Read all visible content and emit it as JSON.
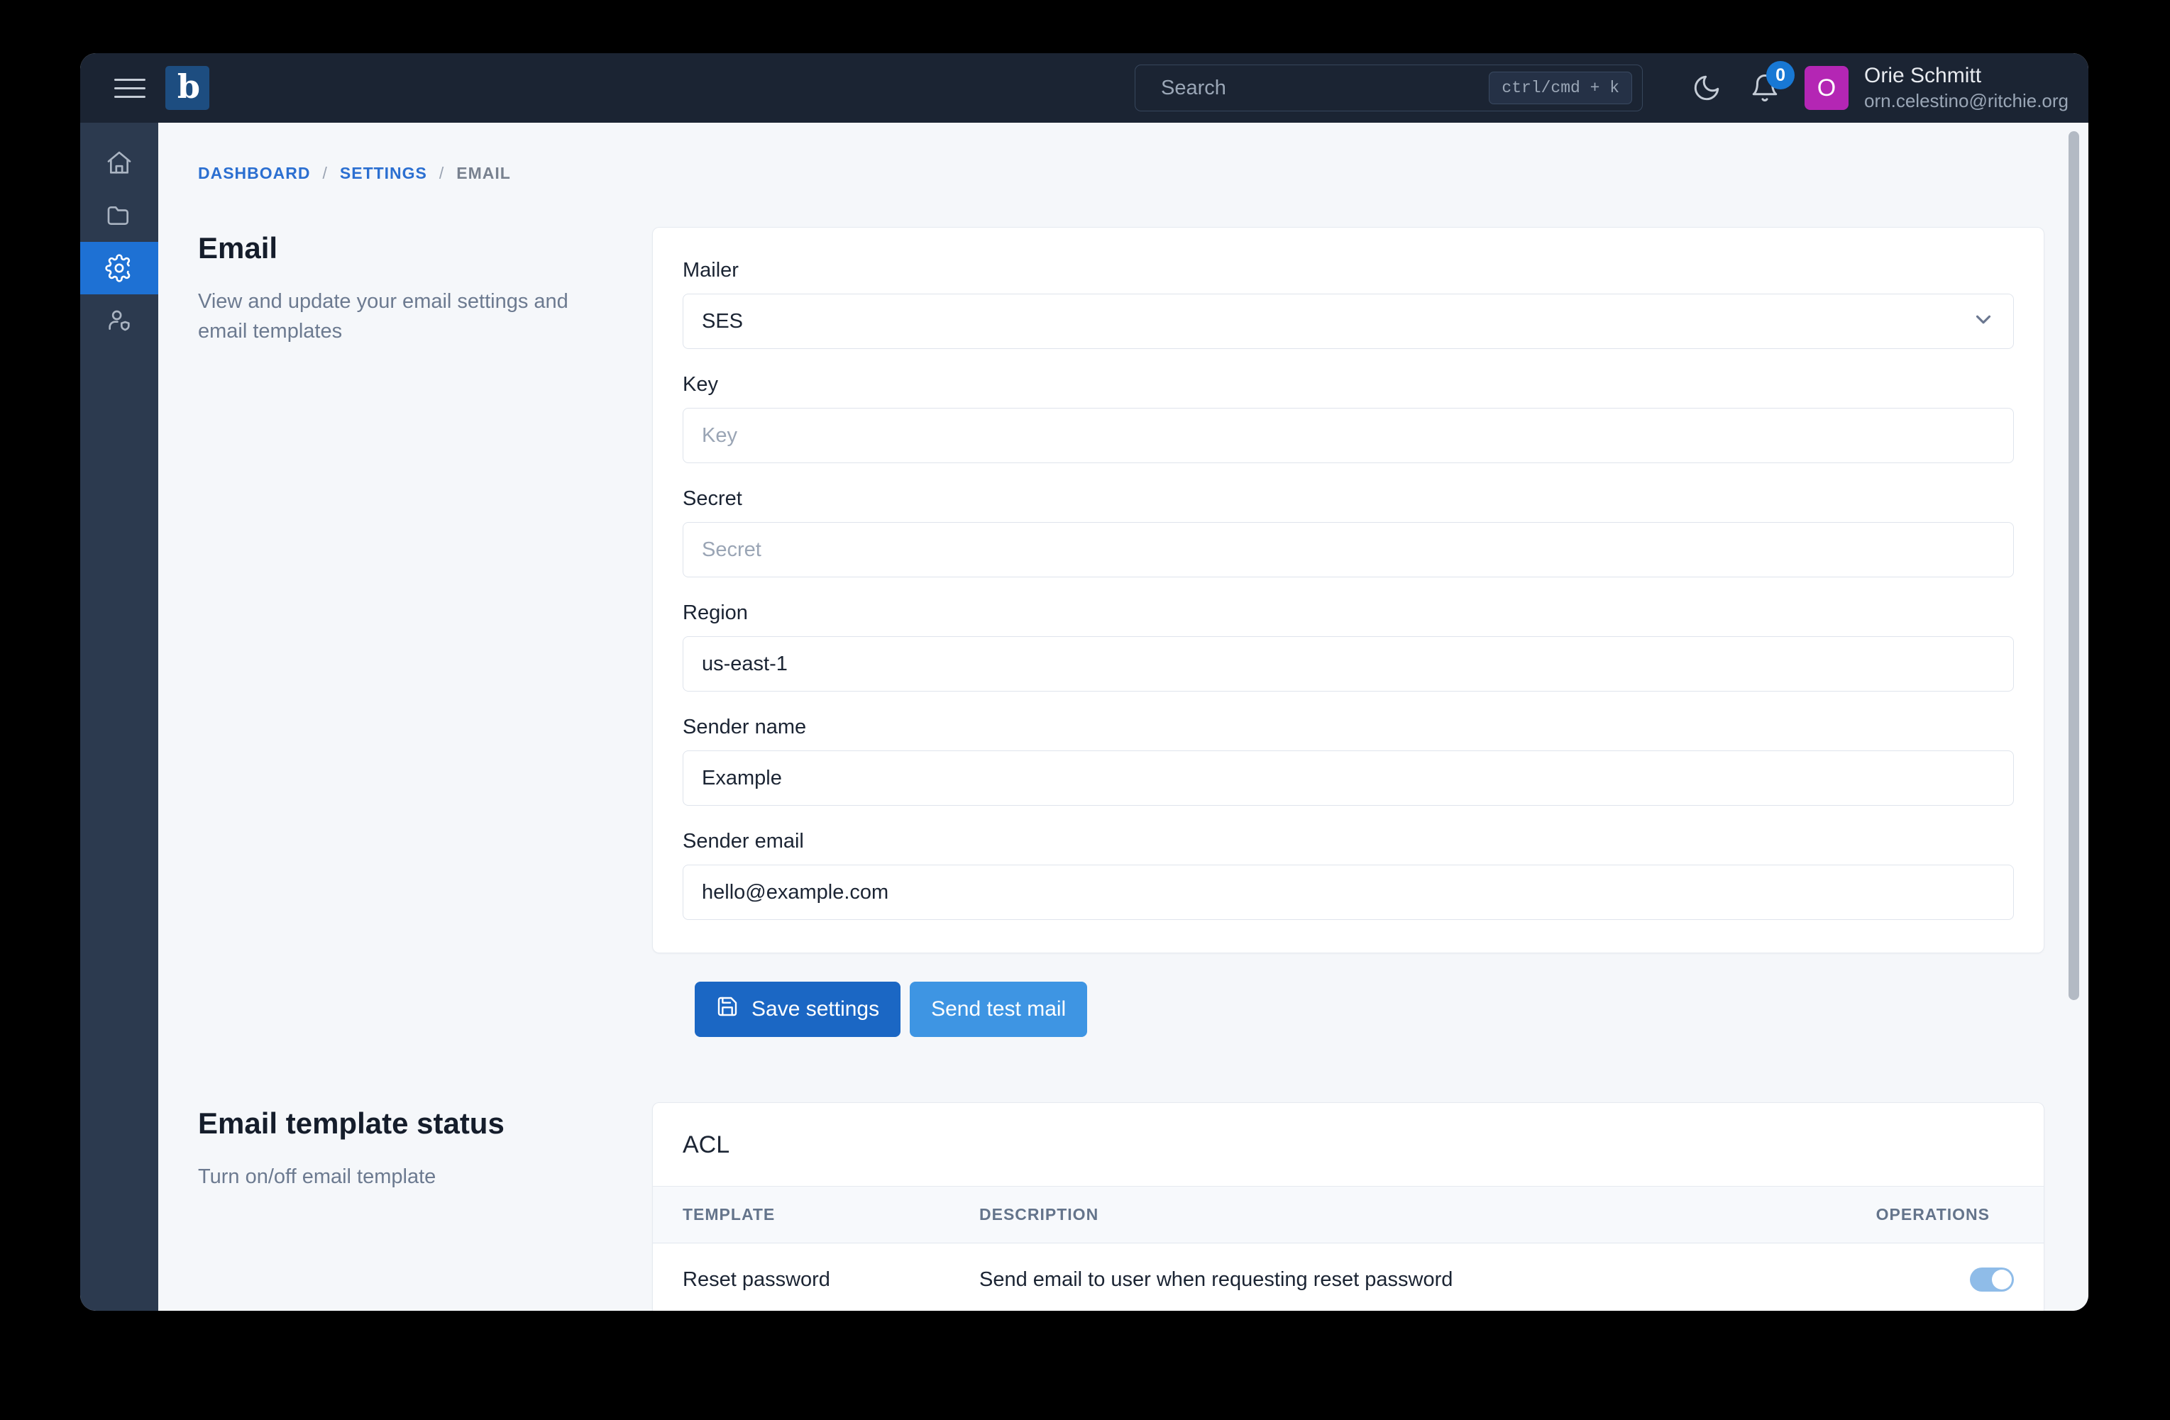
{
  "topbar": {
    "menu_label": "Menu",
    "brand_letter": "b",
    "search": {
      "placeholder": "Search",
      "shortcut": "ctrl/cmd + k"
    },
    "theme_toggle_label": "Dark mode",
    "notifications_count": "0",
    "user": {
      "initial": "O",
      "name": "Orie Schmitt",
      "email": "orn.celestino@ritchie.org",
      "avatar_color": "#b426b4"
    }
  },
  "sidebar": {
    "items": [
      {
        "id": "home",
        "icon": "home-icon",
        "active": false
      },
      {
        "id": "files",
        "icon": "folder-icon",
        "active": false
      },
      {
        "id": "settings",
        "icon": "gear-icon",
        "active": true
      },
      {
        "id": "users",
        "icon": "user-shield-icon",
        "active": false
      }
    ],
    "active_color": "#1e71d4"
  },
  "breadcrumb": {
    "items": [
      {
        "label": "DASHBOARD",
        "link": true
      },
      {
        "label": "SETTINGS",
        "link": true
      },
      {
        "label": "EMAIL",
        "link": false
      }
    ],
    "separator": "/"
  },
  "email_section": {
    "title": "Email",
    "description": "View and update your email settings and email templates",
    "fields": {
      "mailer": {
        "label": "Mailer",
        "value": "SES",
        "type": "select"
      },
      "key": {
        "label": "Key",
        "value": "",
        "placeholder": "Key"
      },
      "secret": {
        "label": "Secret",
        "value": "",
        "placeholder": "Secret"
      },
      "region": {
        "label": "Region",
        "value": "us-east-1",
        "placeholder": "Region"
      },
      "sender_name": {
        "label": "Sender name",
        "value": "Example",
        "placeholder": "Sender name"
      },
      "sender_email": {
        "label": "Sender email",
        "value": "hello@example.com",
        "placeholder": "Sender email"
      }
    }
  },
  "actions": {
    "save_label": "Save settings",
    "save_icon": "save-icon",
    "save_color": "#1b67c4",
    "test_label": "Send test mail",
    "test_color": "#3e95e3"
  },
  "template_section": {
    "title": "Email template status",
    "description": "Turn on/off email template",
    "card_title": "ACL",
    "columns": [
      "TEMPLATE",
      "DESCRIPTION",
      "OPERATIONS"
    ],
    "rows": [
      {
        "template": "Reset password",
        "description": "Send email to user when requesting reset password",
        "enabled": "on"
      }
    ]
  }
}
